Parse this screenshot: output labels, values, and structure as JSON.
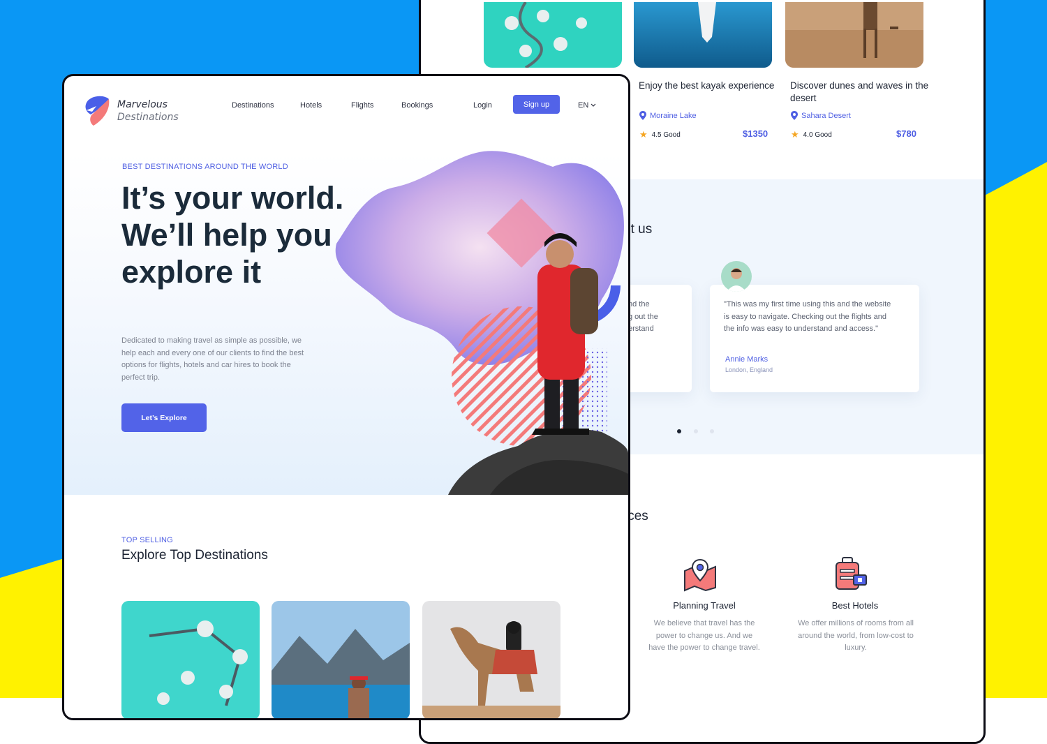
{
  "colors": {
    "accent": "#5263e8",
    "blue_bg": "#0a97f5",
    "yellow_bg": "#fff200",
    "dark_text": "#1b2b3a",
    "coral": "#f47a7a"
  },
  "back": {
    "cards": [
      {
        "title": "Enjoy the best kayak experience",
        "location": "Moraine Lake",
        "rating": "4.5 Good",
        "price": "$1350"
      },
      {
        "title": "Discover dunes and waves in the desert",
        "location": "Sahara Desert",
        "rating": "4.0 Good",
        "price": "$780"
      }
    ],
    "testimonials_heading_partial": "ut us",
    "testimonial_left_partial": [
      "nd the",
      "g out the",
      "erstand"
    ],
    "testimonial": {
      "quote": "\"This was my first time using this and the website is easy to navigate. Checking out the flights and the info was easy to understand and access.\"",
      "name": "Annie Marks",
      "location": "London, England"
    },
    "services_heading_partial": "ices",
    "services": [
      {
        "title": "Planning Travel",
        "icon": "map-pin-icon",
        "text": "We believe that travel has the power to change us. And we have the power to change travel."
      },
      {
        "title": "Best Hotels",
        "icon": "luggage-icon",
        "text": "We offer millions of rooms from all around the world, from low-cost to luxury."
      }
    ]
  },
  "front": {
    "logo": {
      "line1": "Marvelous",
      "line2": "Destinations"
    },
    "nav": [
      "Destinations",
      "Hotels",
      "Flights",
      "Bookings"
    ],
    "login": "Login",
    "signup": "Sign up",
    "language": "EN",
    "hero": {
      "eyebrow": "BEST DESTINATIONS AROUND THE WORLD",
      "title": "It’s your world. We’ll help you explore it",
      "description": "Dedicated to making travel as simple as possible, we help each and every one of our clients to find the best options for flights, hotels and car hires to book the perfect trip.",
      "cta": "Let’s Explore"
    },
    "top": {
      "eyebrow": "TOP SELLING",
      "title": "Explore Top Destinations"
    }
  }
}
